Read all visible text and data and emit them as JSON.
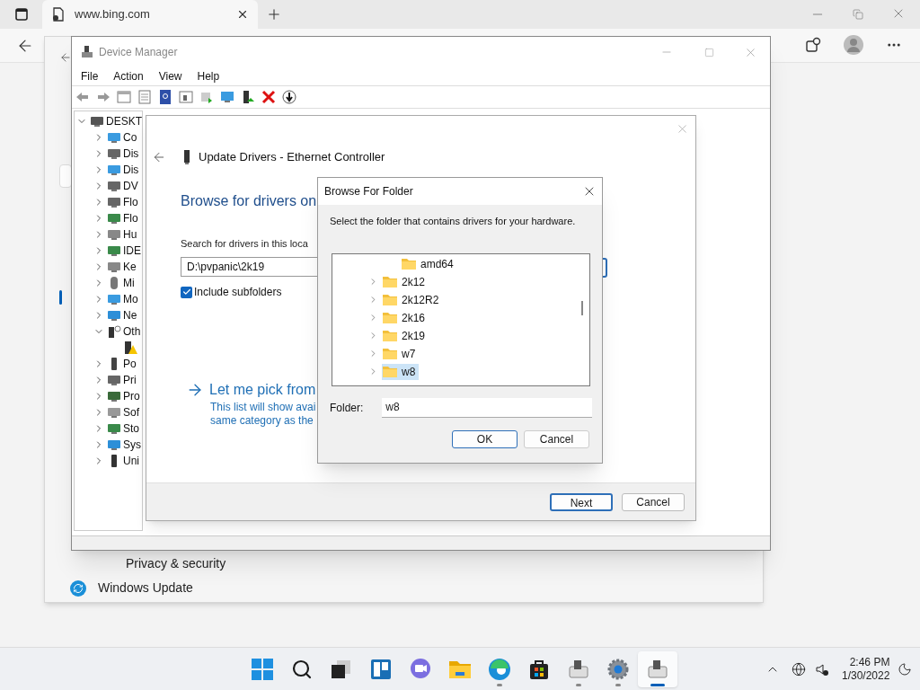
{
  "browser": {
    "tab_title": "www.bing.com"
  },
  "settings": {
    "items": [
      {
        "label": "Privacy & security"
      },
      {
        "label": "Windows Update"
      }
    ]
  },
  "device_manager": {
    "title": "Device Manager",
    "menu": [
      "File",
      "Action",
      "View",
      "Help"
    ],
    "tree": {
      "label": "DESKT",
      "kind": "computer",
      "expanded": true,
      "children": [
        {
          "label": "Co",
          "kind": "monitor",
          "expanded": false
        },
        {
          "label": "Dis",
          "kind": "drive",
          "expanded": false
        },
        {
          "label": "Dis",
          "kind": "display",
          "expanded": false
        },
        {
          "label": "DV",
          "kind": "drive",
          "expanded": false
        },
        {
          "label": "Flo",
          "kind": "drive",
          "expanded": false
        },
        {
          "label": "Flo",
          "kind": "board",
          "expanded": false
        },
        {
          "label": "Hu",
          "kind": "keyboard",
          "expanded": false
        },
        {
          "label": "IDE",
          "kind": "board",
          "expanded": false
        },
        {
          "label": "Ke",
          "kind": "keyboard",
          "expanded": false
        },
        {
          "label": "Mi",
          "kind": "mouse",
          "expanded": false
        },
        {
          "label": "Mo",
          "kind": "monitor",
          "expanded": false
        },
        {
          "label": "Ne",
          "kind": "network",
          "expanded": false
        },
        {
          "label": "Oth",
          "kind": "unknown",
          "expanded": true,
          "children": [
            {
              "kind": "warning"
            }
          ]
        },
        {
          "label": "Po",
          "kind": "port",
          "expanded": false
        },
        {
          "label": "Pri",
          "kind": "printer",
          "expanded": false
        },
        {
          "label": "Pro",
          "kind": "chip",
          "expanded": false
        },
        {
          "label": "Sof",
          "kind": "software",
          "expanded": false
        },
        {
          "label": "Sto",
          "kind": "storage",
          "expanded": false
        },
        {
          "label": "Sys",
          "kind": "system",
          "expanded": false
        },
        {
          "label": "Uni",
          "kind": "usb",
          "expanded": false
        }
      ]
    }
  },
  "update_dialog": {
    "title": "Update Drivers - Ethernet Controller",
    "heading": "Browse for drivers on",
    "location_label": "Search for drivers in this loca",
    "path": "D:\\pvpanic\\2k19",
    "include_subfolders": {
      "label": "Include subfolders",
      "checked": true
    },
    "pick_link": "Let me pick from",
    "pick_description": [
      "This list will show avai",
      "same category as the"
    ],
    "buttons": [
      {
        "label": "Next",
        "default": true
      },
      {
        "label": "Cancel",
        "default": false
      }
    ]
  },
  "browse_dialog": {
    "title": "Browse For Folder",
    "instruction": "Select the folder that contains drivers for your hardware.",
    "subfolders": [
      {
        "label": "amd64",
        "selected": false
      }
    ],
    "folders": [
      {
        "label": "2k12",
        "selected": false
      },
      {
        "label": "2k12R2",
        "selected": false
      },
      {
        "label": "2k16",
        "selected": false
      },
      {
        "label": "2k19",
        "selected": false
      },
      {
        "label": "w7",
        "selected": false
      },
      {
        "label": "w8",
        "selected": true
      }
    ],
    "folder_label": "Folder:",
    "folder_value": "w8",
    "buttons": [
      {
        "label": "OK",
        "default": true
      },
      {
        "label": "Cancel",
        "default": false
      }
    ]
  },
  "taskbar": {
    "apps": [
      {
        "kind": "start",
        "running": false,
        "selected": false
      },
      {
        "kind": "search",
        "running": false,
        "selected": false
      },
      {
        "kind": "taskview",
        "running": false,
        "selected": false
      },
      {
        "kind": "widgets",
        "running": false,
        "selected": false
      },
      {
        "kind": "chat",
        "running": false,
        "selected": false
      },
      {
        "kind": "explorer",
        "running": false,
        "selected": false
      },
      {
        "kind": "edge",
        "running": true,
        "selected": false
      },
      {
        "kind": "store",
        "running": false,
        "selected": false
      },
      {
        "kind": "device",
        "running": true,
        "selected": false
      },
      {
        "kind": "settings",
        "running": true,
        "selected": false
      },
      {
        "kind": "device",
        "running": true,
        "selected": true
      }
    ],
    "time": "2:46 PM",
    "date": "1/30/2022"
  }
}
